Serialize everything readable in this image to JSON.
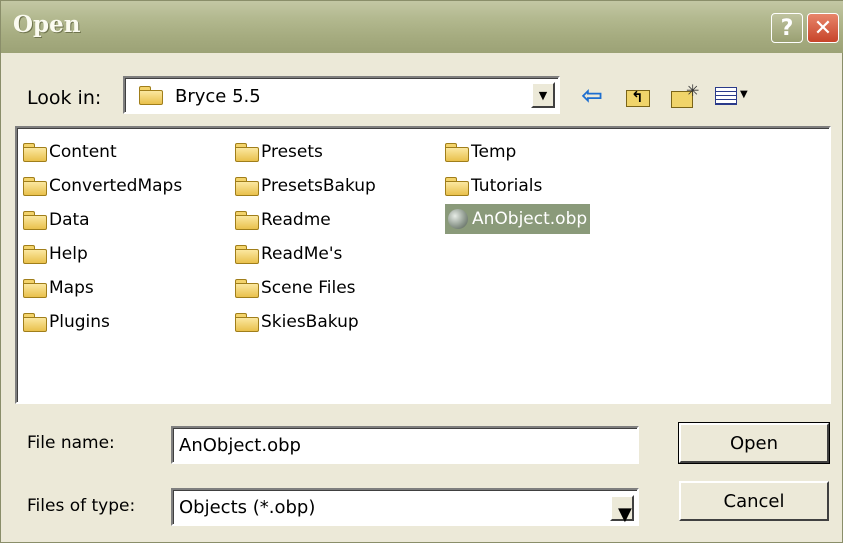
{
  "window": {
    "title": "Open",
    "help_glyph": "?",
    "close_glyph": "✕"
  },
  "look_in": {
    "label": "Look in:",
    "value": "Bryce 5.5"
  },
  "toolbar": {
    "icons": [
      "back-arrow-icon",
      "up-folder-icon",
      "new-folder-icon",
      "view-menu-icon"
    ]
  },
  "files": {
    "columns": [
      [
        "Content",
        "ConvertedMaps",
        "Data",
        "Help",
        "Maps",
        "Plugins"
      ],
      [
        "Presets",
        "PresetsBakup",
        "Readme",
        "ReadMe's",
        "Scene Files",
        "SkiesBakup"
      ],
      [
        "Temp",
        "Tutorials",
        "AnObject.obp"
      ]
    ],
    "selected": "AnObject.obp"
  },
  "file_name": {
    "label": "File name:",
    "value": "AnObject.obp"
  },
  "file_type": {
    "label": "Files of type:",
    "value": "Objects (*.obp)"
  },
  "buttons": {
    "open": "Open",
    "cancel": "Cancel"
  },
  "colors": {
    "titlebar": "#a5ab7f",
    "selection": "#8a9a7a",
    "face": "#ece9d8"
  }
}
